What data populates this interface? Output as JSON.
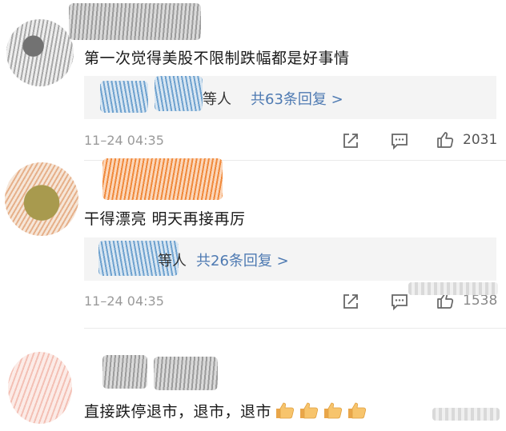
{
  "comments": [
    {
      "text": "第一次觉得美股不限制跌幅都是好事情",
      "replies_prefix": "等人",
      "replies_link": "共63条回复 >",
      "time": "11–24 04:35",
      "likes": "2031"
    },
    {
      "text": "干得漂亮 明天再接再厉",
      "replies_prefix": "等人",
      "replies_link": "共26条回复 >",
      "time": "11–24 04:35",
      "likes": "1538"
    },
    {
      "text": "直接跌停退市，退市，退市"
    }
  ],
  "icons": {
    "share": "share-icon",
    "comment": "comment-icon",
    "like": "thumbs-up-icon",
    "thumbs_emoji": "thumbs-up-emoji"
  },
  "colors": {
    "link": "#4e7ab2",
    "time": "#9a9a9a",
    "reply_bg": "#f4f4f4"
  }
}
